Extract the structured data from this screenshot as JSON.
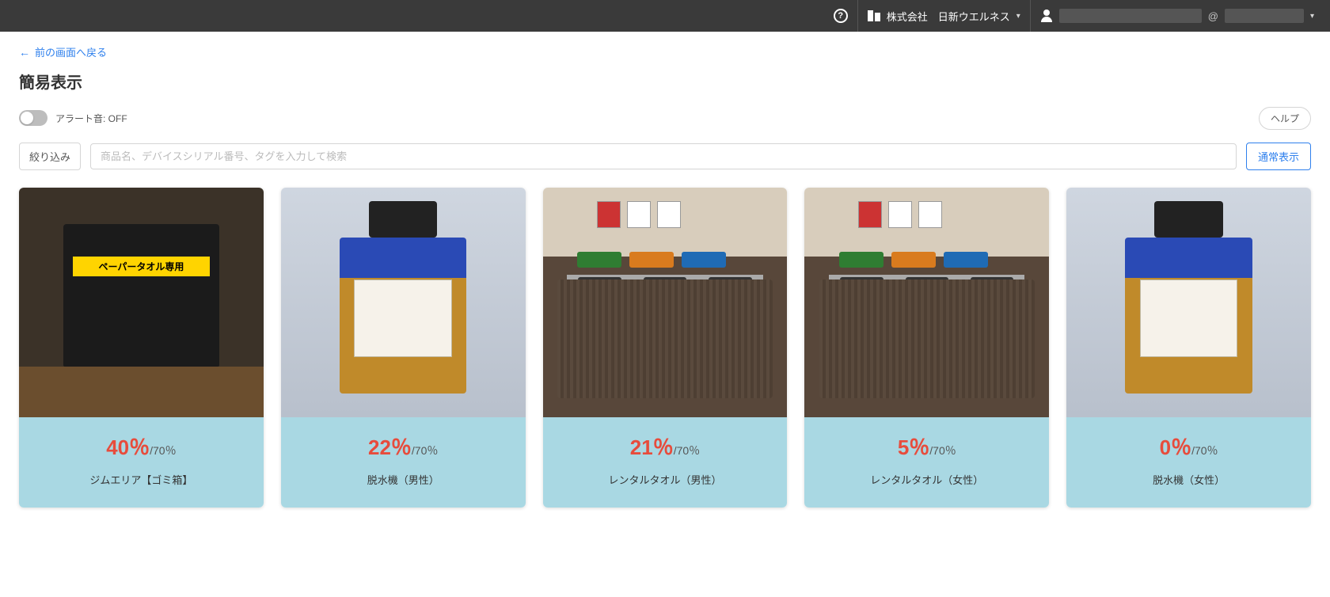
{
  "header": {
    "company_name": "株式会社　日新ウエルネス",
    "email_at": "@"
  },
  "nav": {
    "back_label": "前の画面へ戻る"
  },
  "title": "簡易表示",
  "alert": {
    "prefix": "アラート音: ",
    "state": "OFF"
  },
  "buttons": {
    "help": "ヘルプ",
    "filter": "絞り込み",
    "normal_view": "通常表示"
  },
  "search": {
    "placeholder": "商品名、デバイスシリアル番号、タグを入力して検索"
  },
  "cards": [
    {
      "percent": "40％",
      "threshold": "/70％",
      "label": "ジムエリア【ゴミ箱】",
      "thumb": "bin-gym"
    },
    {
      "percent": "22％",
      "threshold": "/70％",
      "label": "脱水機（男性）",
      "thumb": "dehydrator"
    },
    {
      "percent": "21％",
      "threshold": "/70％",
      "label": "レンタルタオル（男性）",
      "thumb": "rental"
    },
    {
      "percent": "5％",
      "threshold": "/70％",
      "label": "レンタルタオル（女性）",
      "thumb": "rental"
    },
    {
      "percent": "0％",
      "threshold": "/70％",
      "label": "脱水機（女性）",
      "thumb": "dehydrator"
    }
  ]
}
